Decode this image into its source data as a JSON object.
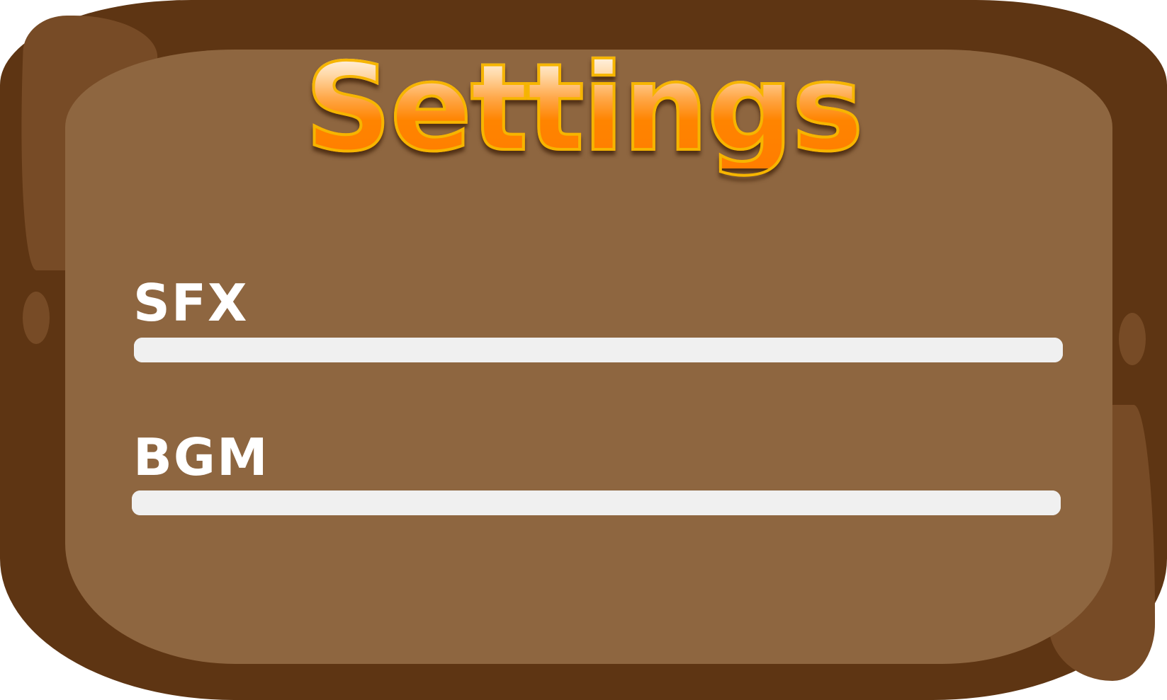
{
  "title": "Settings",
  "colors": {
    "frame": "#5e3513",
    "panel": "#8e6640",
    "highlight": "#774b26",
    "title_fill": "#ff8400",
    "title_outline": "#f6b500",
    "label": "#ffffff",
    "slider_track": "#f0f0f0"
  },
  "settings": {
    "sfx": {
      "label": "SFX",
      "volume": 1.0
    },
    "bgm": {
      "label": "BGM",
      "volume": 1.0
    }
  }
}
